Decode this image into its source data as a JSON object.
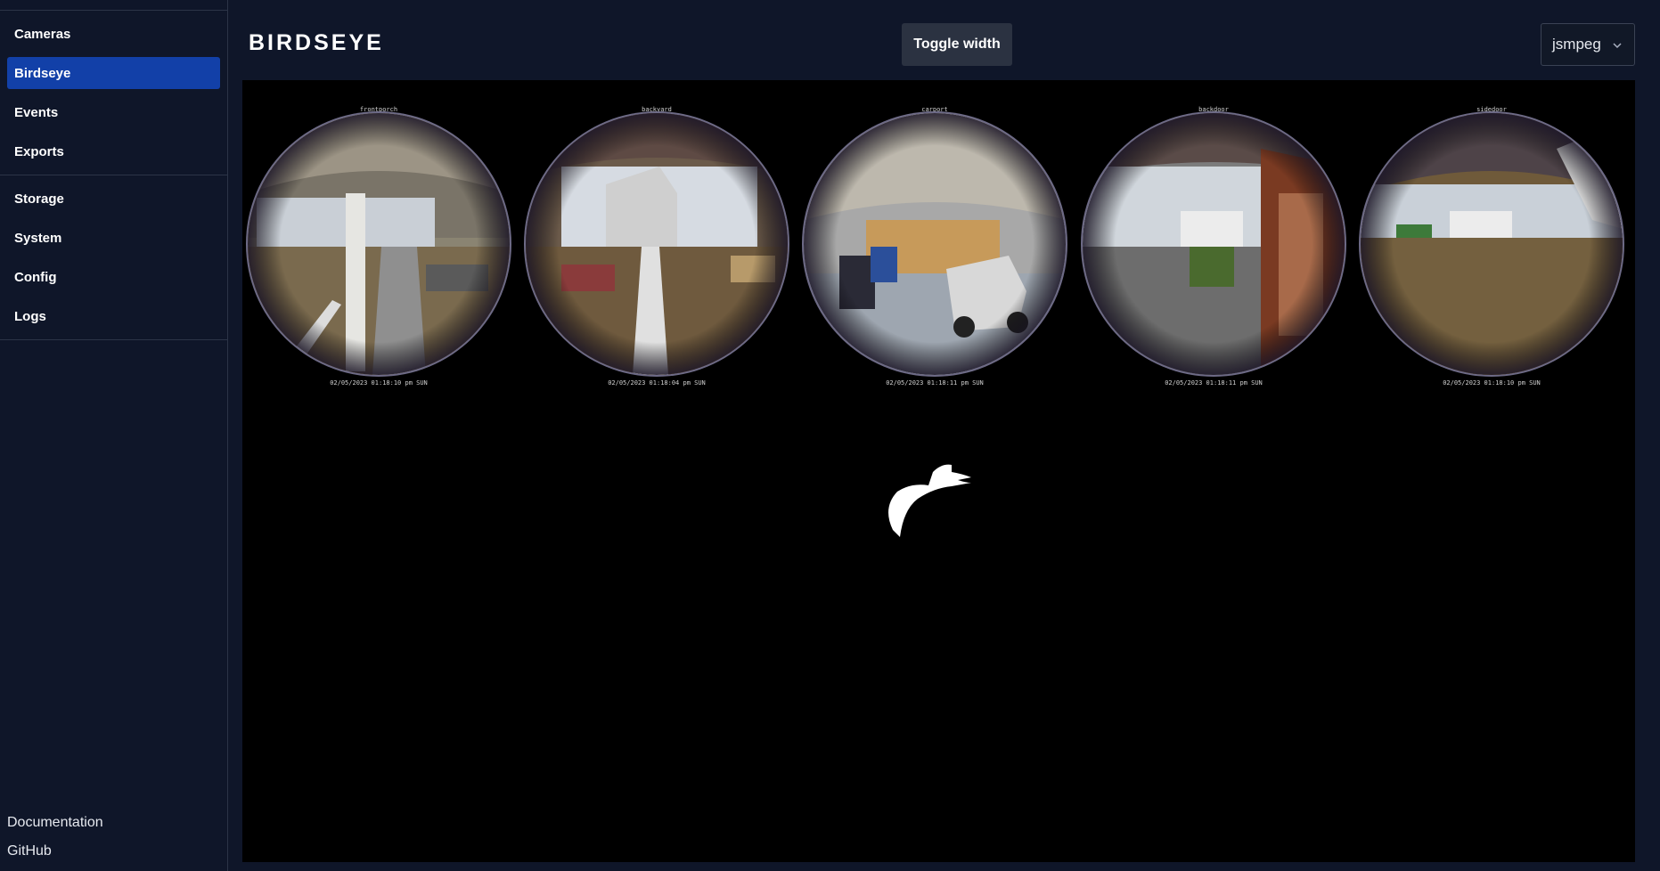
{
  "sidebar": {
    "nav_primary": [
      {
        "label": "Cameras",
        "active": false
      },
      {
        "label": "Birdseye",
        "active": true
      },
      {
        "label": "Events",
        "active": false
      },
      {
        "label": "Exports",
        "active": false
      }
    ],
    "nav_secondary": [
      {
        "label": "Storage"
      },
      {
        "label": "System"
      },
      {
        "label": "Config"
      },
      {
        "label": "Logs"
      }
    ],
    "footer": {
      "documentation": "Documentation",
      "github": "GitHub"
    }
  },
  "header": {
    "title": "BIRDSEYE",
    "toggle_label": "Toggle width",
    "source_value": "jsmpeg"
  },
  "cameras": [
    {
      "name": "frontporch",
      "timestamp": "02/05/2023 01:18:10 pm SUN"
    },
    {
      "name": "backyard",
      "timestamp": "02/05/2023 01:18:04 pm SUN"
    },
    {
      "name": "carport",
      "timestamp": "02/05/2023 01:18:11 pm SUN"
    },
    {
      "name": "backdoor",
      "timestamp": "02/05/2023 01:18:11 pm SUN"
    },
    {
      "name": "sidedoor",
      "timestamp": "02/05/2023 01:18:10 pm SUN"
    }
  ],
  "colors": {
    "background": "#0f1629",
    "active_nav": "#1240a8",
    "button": "#2b3241",
    "stream_bg": "#000000"
  },
  "icons": {
    "select": "chevron-down-icon",
    "logo": "frigate-bird-logo"
  }
}
